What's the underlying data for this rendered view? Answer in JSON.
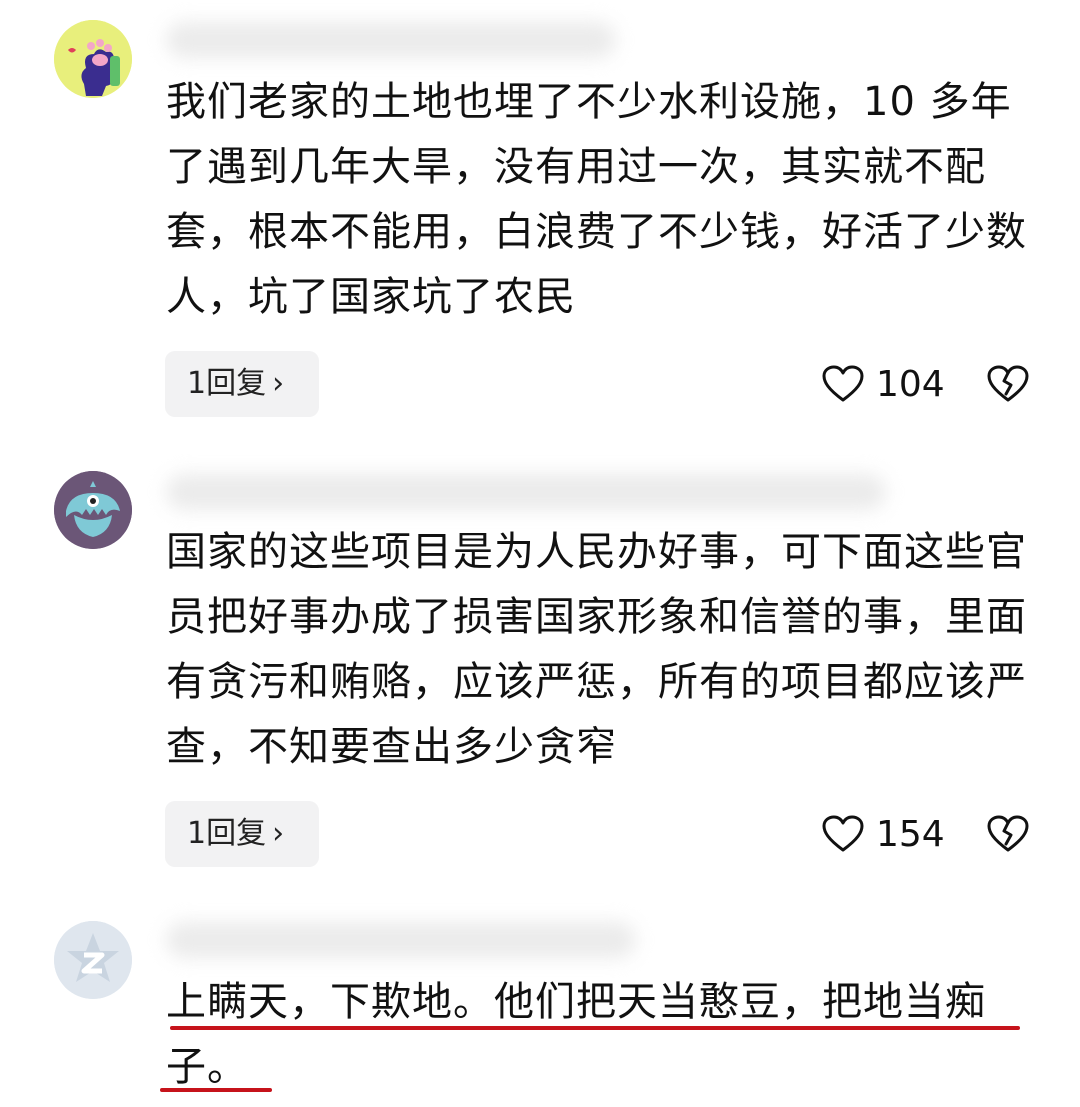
{
  "comments": [
    {
      "text": "我们老家的土地也埋了不少水利设施，10 多年了遇到几年大旱，没有用过一次，其实就不配套，根本不能用，白浪费了不少钱，好活了少数人，坑了国家坑了农民",
      "reply_label": "1回复",
      "likes": "104",
      "avatar_icon": "paw-icon",
      "avatar_bg": "#e8ef7c"
    },
    {
      "text": "国家的这些项目是为人民办好事，可下面这些官员把好事办成了损害国家形象和信誉的事，里面有贪污和贿赂，应该严惩，所有的项目都应该严查，不知要查出多少贪窄",
      "reply_label": "1回复",
      "likes": "154",
      "avatar_icon": "monster-icon",
      "avatar_bg": "#6b5677"
    },
    {
      "text": "上瞒天，下欺地。他们把天当憨豆，把地当痴子。",
      "avatar_icon": "star-z-icon",
      "avatar_bg": "#dfe6ee"
    }
  ],
  "colors": {
    "underline": "#c6131b",
    "reply_bg": "#f2f2f3"
  }
}
